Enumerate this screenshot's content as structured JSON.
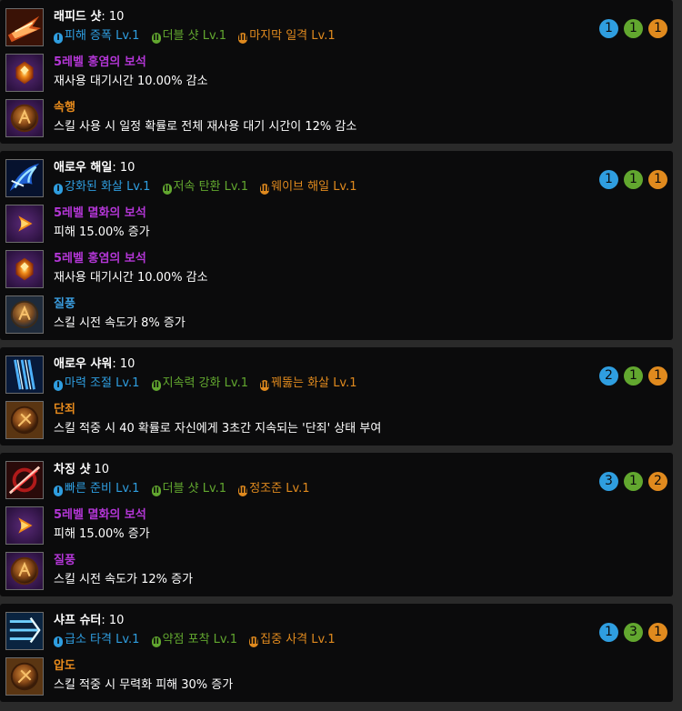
{
  "colors": {
    "tripod1": "#2f9ee0",
    "tripod2": "#62a72f",
    "tripod3": "#e08a1e",
    "gem": "#b336d6",
    "rune_orange": "#e88b1c",
    "rune_blue": "#3a9de0"
  },
  "skills": [
    {
      "name": "래피드 샷",
      "level": ": 10",
      "tripods": [
        "피해 증폭 Lv.1",
        "더블 샷 Lv.1",
        "마지막 일격 Lv.1"
      ],
      "tripod_levels": [
        "1",
        "1",
        "1"
      ],
      "extras": [
        {
          "title": "5레벨 홍염의 보석",
          "desc": "재사용 대기시간 10.00% 감소",
          "icon": "red-gem-icon"
        },
        {
          "title": "속행",
          "desc": "스킬 사용 시 일정 확률로 전체 재사용 대기 시간이 12% 감소",
          "icon": "rune-icon"
        }
      ]
    },
    {
      "name": "애로우 해일",
      "level": ": 10",
      "tripods": [
        "강화된 화살 Lv.1",
        "저속 탄환 Lv.1",
        "웨이브 해일 Lv.1"
      ],
      "tripod_levels": [
        "1",
        "1",
        "1"
      ],
      "extras": [
        {
          "title": "5레벨 멸화의 보석",
          "desc": "피해 15.00% 증가",
          "icon": "purple-gem-icon"
        },
        {
          "title": "5레벨 홍염의 보석",
          "desc": "재사용 대기시간 10.00% 감소",
          "icon": "red-gem-icon"
        },
        {
          "title": "질풍",
          "desc": "스킬 시전 속도가 8% 증가",
          "icon": "rune-icon"
        }
      ]
    },
    {
      "name": "애로우 샤워",
      "level": ": 10",
      "tripods": [
        "마력 조절 Lv.1",
        "지속력 강화 Lv.1",
        "꿰뚫는 화살 Lv.1"
      ],
      "tripod_levels": [
        "2",
        "1",
        "1"
      ],
      "extras": [
        {
          "title": "단죄",
          "desc": "스킬 적중 시 40 확률로 자신에게 3초간 지속되는 '단죄' 상태 부여",
          "icon": "rune-icon"
        }
      ]
    },
    {
      "name": "차징 샷",
      "level": " 10",
      "tripods": [
        "빠른 준비 Lv.1",
        "더블 샷 Lv.1",
        "정조준 Lv.1"
      ],
      "tripod_levels": [
        "3",
        "1",
        "2"
      ],
      "extras": [
        {
          "title": "5레벨 멸화의 보석",
          "desc": "피해 15.00% 증가",
          "icon": "purple-gem-icon"
        },
        {
          "title": "질풍",
          "desc": "스킬 시전 속도가 12% 증가",
          "icon": "rune-icon"
        }
      ]
    },
    {
      "name": "샤프 슈터",
      "level": ": 10",
      "tripods": [
        "급소 타격 Lv.1",
        "약점 포착 Lv.1",
        "집중 사격 Lv.1"
      ],
      "tripod_levels": [
        "1",
        "3",
        "1"
      ],
      "extras": [
        {
          "title": "압도",
          "desc": "스킬 적중 시 무력화 피해 30% 증가",
          "icon": "rune-icon"
        }
      ]
    }
  ]
}
